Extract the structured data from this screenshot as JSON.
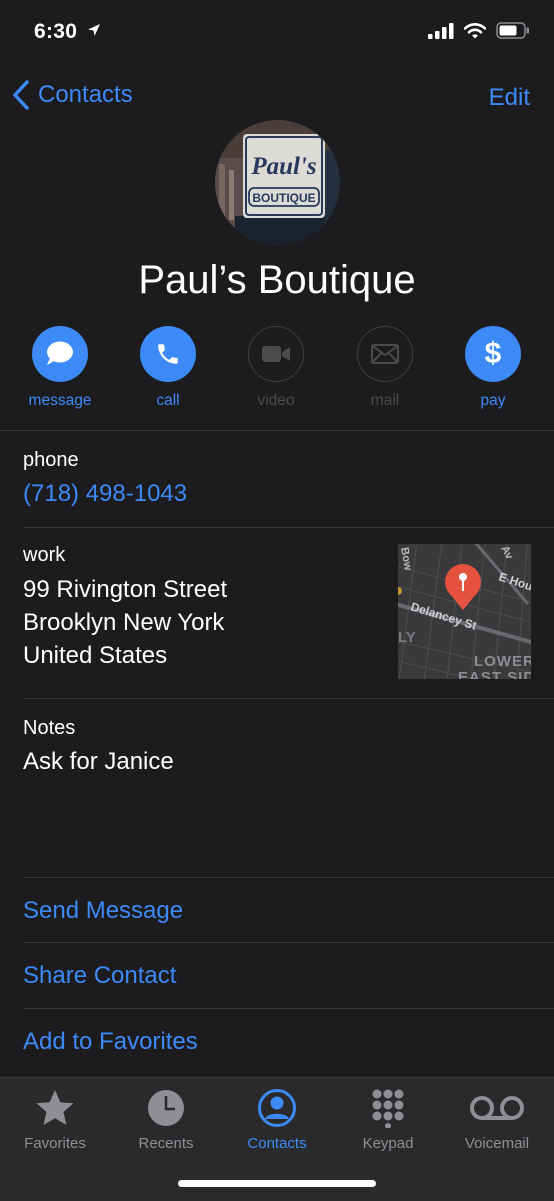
{
  "status": {
    "time": "6:30"
  },
  "nav": {
    "back_label": "Contacts",
    "edit_label": "Edit"
  },
  "avatar": {
    "sign_line1": "Paul's",
    "sign_line2": "BOUTIQUE"
  },
  "contact": {
    "name": "Paul’s Boutique"
  },
  "actions": [
    {
      "label": "message",
      "enabled": true,
      "icon": "message-bubble-icon"
    },
    {
      "label": "call",
      "enabled": true,
      "icon": "phone-icon"
    },
    {
      "label": "video",
      "enabled": false,
      "icon": "video-camera-icon"
    },
    {
      "label": "mail",
      "enabled": false,
      "icon": "envelope-icon"
    },
    {
      "label": "pay",
      "enabled": true,
      "icon": "dollar-icon"
    }
  ],
  "phone": {
    "label": "phone",
    "value": "(718) 498-1043"
  },
  "address": {
    "label": "work",
    "lines": [
      "99 Rivington Street",
      "Brooklyn New York",
      "United States"
    ],
    "map": {
      "street_label": "Delancey St",
      "street2_label": "E Hou",
      "street3_label": "Bow",
      "street4_label": "Av",
      "area_line1": "LOWER",
      "area_line2": "EAST SID"
    }
  },
  "notes": {
    "label": "Notes",
    "value": "Ask for Janice"
  },
  "links": [
    "Send Message",
    "Share Contact",
    "Add to Favorites"
  ],
  "tabs": [
    {
      "label": "Favorites",
      "icon": "star-icon",
      "active": false
    },
    {
      "label": "Recents",
      "icon": "clock-icon",
      "active": false
    },
    {
      "label": "Contacts",
      "icon": "person-circle-icon",
      "active": true
    },
    {
      "label": "Keypad",
      "icon": "keypad-icon",
      "active": false
    },
    {
      "label": "Voicemail",
      "icon": "voicemail-icon",
      "active": false
    }
  ],
  "colors": {
    "accent": "#3d8af7",
    "background": "#1c1c1e",
    "disabled": "#4b4b4d",
    "pin": "#e5523f"
  }
}
